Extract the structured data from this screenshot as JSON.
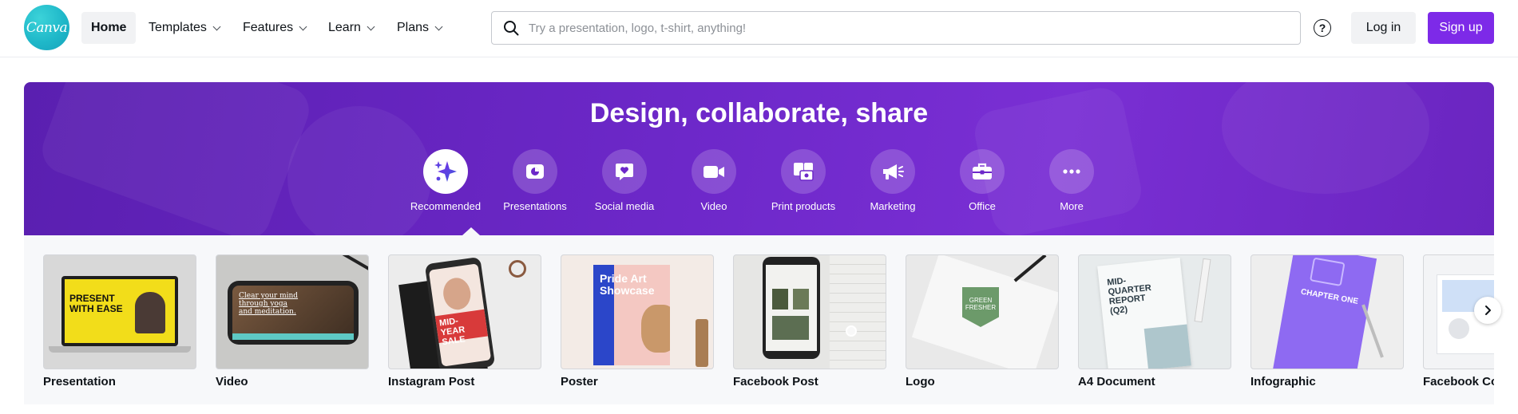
{
  "brand": {
    "logo_text": "Canva",
    "accent": "#7d2ae8",
    "logo_color": "#1fb8c9"
  },
  "nav": {
    "items": [
      {
        "label": "Home",
        "active": true
      },
      {
        "label": "Templates",
        "dropdown": true
      },
      {
        "label": "Features",
        "dropdown": true
      },
      {
        "label": "Learn",
        "dropdown": true
      },
      {
        "label": "Plans",
        "dropdown": true
      }
    ]
  },
  "search": {
    "placeholder": "Try a presentation, logo, t-shirt, anything!",
    "value": "",
    "icon": "search-icon"
  },
  "header_actions": {
    "help_glyph": "?",
    "login_label": "Log in",
    "signup_label": "Sign up"
  },
  "hero": {
    "title": "Design, collaborate, share",
    "categories": [
      {
        "label": "Recommended",
        "icon": "sparkle-icon",
        "selected": true
      },
      {
        "label": "Presentations",
        "icon": "presentation-icon"
      },
      {
        "label": "Social media",
        "icon": "heart-chat-icon"
      },
      {
        "label": "Video",
        "icon": "video-camera-icon"
      },
      {
        "label": "Print products",
        "icon": "print-products-icon"
      },
      {
        "label": "Marketing",
        "icon": "megaphone-icon"
      },
      {
        "label": "Office",
        "icon": "briefcase-icon"
      },
      {
        "label": "More",
        "icon": "more-dots-icon"
      }
    ]
  },
  "templates": {
    "items": [
      {
        "label": "Presentation",
        "thumb_text": "PRESENT WITH EASE"
      },
      {
        "label": "Video",
        "thumb_text": "Clear your mind through yoga and meditation."
      },
      {
        "label": "Instagram Post",
        "thumb_text": "MID-YEAR SALE"
      },
      {
        "label": "Poster",
        "thumb_text": "Pride Art Showcase"
      },
      {
        "label": "Facebook Post",
        "thumb_text": ""
      },
      {
        "label": "Logo",
        "thumb_text": "GREEN FRESHER"
      },
      {
        "label": "A4 Document",
        "thumb_text": "MID-QUARTER REPORT (Q2)"
      },
      {
        "label": "Infographic",
        "thumb_text": "CHAPTER ONE"
      },
      {
        "label": "Facebook Cover",
        "thumb_text": ""
      }
    ],
    "next_icon": "chevron-right-icon"
  }
}
